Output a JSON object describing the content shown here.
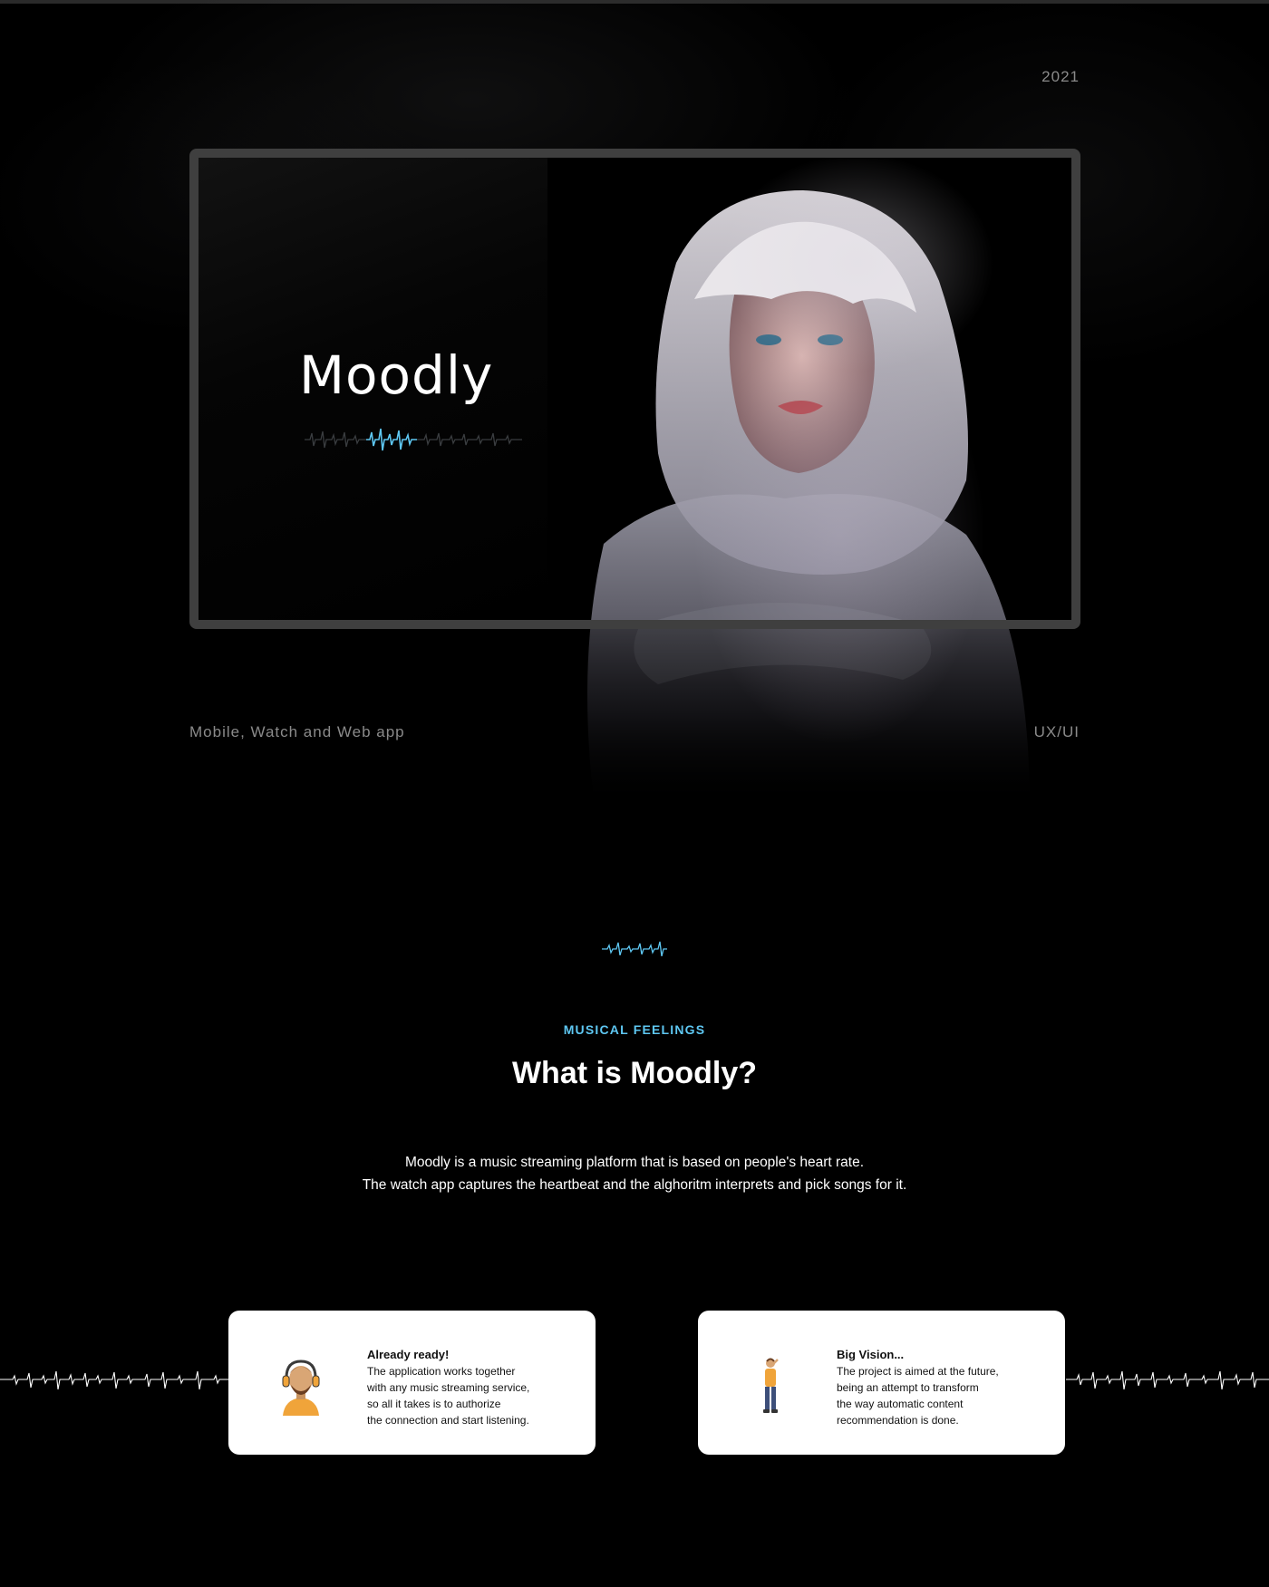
{
  "hero": {
    "year": "2021",
    "brand": "Moodly",
    "platforms": "Mobile, Watch and Web app",
    "discipline": "UX/UI"
  },
  "about": {
    "eyebrow": "MUSICAL FEELINGS",
    "title": "What is Moodly?",
    "description_line1": "Moodly is a music streaming platform that is based on people's heart rate.",
    "description_line2": "The watch app captures the heartbeat and the alghoritm interprets and pick songs for it."
  },
  "cards": [
    {
      "title": "Already ready!",
      "lines": [
        "The application works together",
        "with any music streaming service,",
        "so all it takes is to authorize",
        "the connection and start listening."
      ]
    },
    {
      "title": "Big Vision...",
      "lines": [
        "The project is aimed at the future,",
        "being an attempt to transform",
        "the way automatic content",
        "recommendation is done."
      ]
    }
  ],
  "colors": {
    "background": "#000000",
    "accent": "#5ec7f2",
    "frame": "#3f3f3f",
    "muted_text": "#8a8a8a",
    "card": "#ffffff"
  },
  "icons": {
    "hero_wave": "heartbeat-wave-icon",
    "section_wave": "heartbeat-wave-icon",
    "card1_avatar": "headphones-character-icon",
    "card2_avatar": "standing-character-icon"
  }
}
